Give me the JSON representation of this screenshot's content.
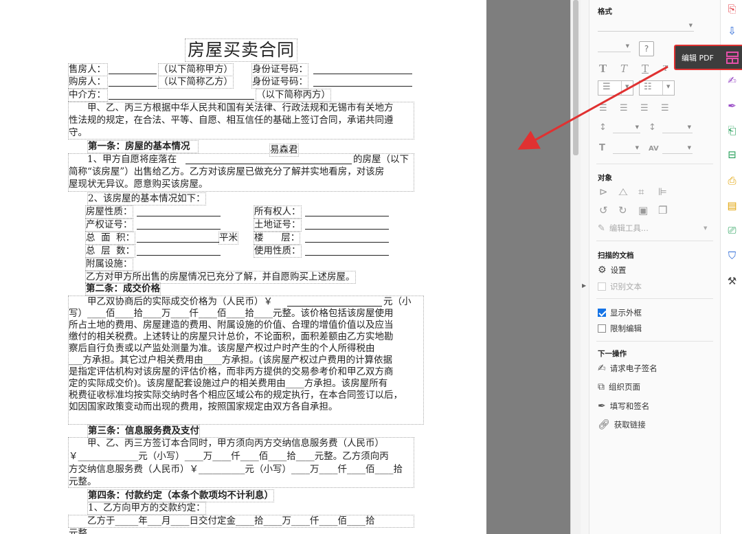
{
  "document": {
    "title": "房屋买卖合同",
    "seller_label": "售房人：",
    "buyer_label": "购房人：",
    "agent_label": "中介方：",
    "seller_short": "（以下简称甲方）",
    "buyer_short": "（以下简称乙方）",
    "agent_short": "（以下简称丙方）",
    "id_label": "身份证号码：",
    "intro": [
      "　　甲、乙、丙三方根据中华人民共和国有关法律、行政法规和无锡市有关地方",
      "性法规的规定，在合法、平等、自愿、相互信任的基础上签订合同，承诺共同遵",
      "守。"
    ],
    "art1_title": "第一条：房屋的基本情况",
    "watermark_name": "易森君",
    "art1_p1": [
      "　　1、甲方自愿将座落在",
      "的房屋（以下",
      "简称“该房屋”）出售给乙方。乙方对该房屋已做充分了解并实地看房，对该房",
      "屋现状无异议。愿意购买该房屋。"
    ],
    "art1_p2": "2、该房屋的基本情况如下：",
    "prop_fields": {
      "nature": "房屋性质：",
      "cert": "产权证号：",
      "area": "总  面  积：",
      "area_unit": "平米",
      "floors": "总  层  数：",
      "attach": "附属设施：",
      "owner": "所有权人：",
      "land": "土地证号：",
      "floor": "楼      层：",
      "usage": "使用性质："
    },
    "art1_p3": "乙方对甲方所出售的房屋情况已充分了解，并自愿购买上述房屋。",
    "art2_title": "第二条：成交价格",
    "art2_lines": [
      "　　甲乙双协商后的实际成交价格为（人民币）￥",
      "元（小",
      "写）____佰____拾____万____仟____佰____拾____元整。该价格包括该房屋使用",
      "所占土地的费用、房屋建造的费用、附属设施的价值、合理的增值价值以及应当",
      "缴付的相关税费。上述转让的房屋只计总价，不论面积，面积差额由乙方实地勘",
      "察后自行负责或以产监处测量为准。该房屋产权过户时产生的个人所得税由",
      "___方承担。其它过户相关费用由____方承担。(该房屋产权过户费用的计算依据",
      "是指定评估机构对该房屋的评估价格，而非丙方提供的交易参考价和甲乙双方商",
      "定的实际成交价)。该房屋配套设施过户的相关费用由____方承担。该房屋所有",
      "税费征收标准均按实际交纳时各个相应区域公布的规定执行，在本合同签订以后，",
      "如因国家政策变动而出现的费用，按照国家规定由双方各自承担。"
    ],
    "art3_title": "第三条：信息服务费及支付",
    "art3_lines": [
      "　　甲、乙、丙三方签订本合同时，甲方须向丙方交纳信息服务费（人民币）",
      "￥_____________元（小写）____万____仟____佰____拾____元整。乙方须向丙",
      "方交纳信息服务费（人民币）￥__________元（小写）____万____仟____佰____拾",
      "元整。"
    ],
    "art4_title": "第四条：付款约定（本条个款项均不计利息）",
    "art4_p1": "1、乙方向甲方的交款约定：",
    "art4_p2": "　　乙方于_____年___月____日交付定金____拾____万____仟____佰____拾",
    "art4_p3": "元整"
  },
  "panel": {
    "format_header": "格式",
    "object_header": "对象",
    "edit_tools": "编辑工具...",
    "scanned_header": "扫描的文档",
    "settings": "设置",
    "recognize_text": "识别文本",
    "show_bbox": "显示外框",
    "restrict_edit": "限制编辑",
    "show_bbox_checked": true,
    "restrict_edit_checked": false,
    "next_header": "下一操作",
    "next_items": [
      "请求电子签名",
      "组织页面",
      "填写和签名",
      "获取链接"
    ]
  },
  "tooltip": {
    "label": "编辑 PDF"
  },
  "colors": {
    "accent": "#1473e6",
    "highlight": "#e03131",
    "gutter": "#7e7e7e"
  },
  "toolbar_icons": [
    "create-pdf-icon",
    "export-pdf-icon",
    "edit-pdf-icon",
    "request-signature-icon",
    "fill-sign-icon",
    "combine-files-icon",
    "organize-pages-icon",
    "export-file-icon",
    "comment-icon",
    "print-production-icon",
    "protect-icon",
    "more-tools-icon"
  ]
}
